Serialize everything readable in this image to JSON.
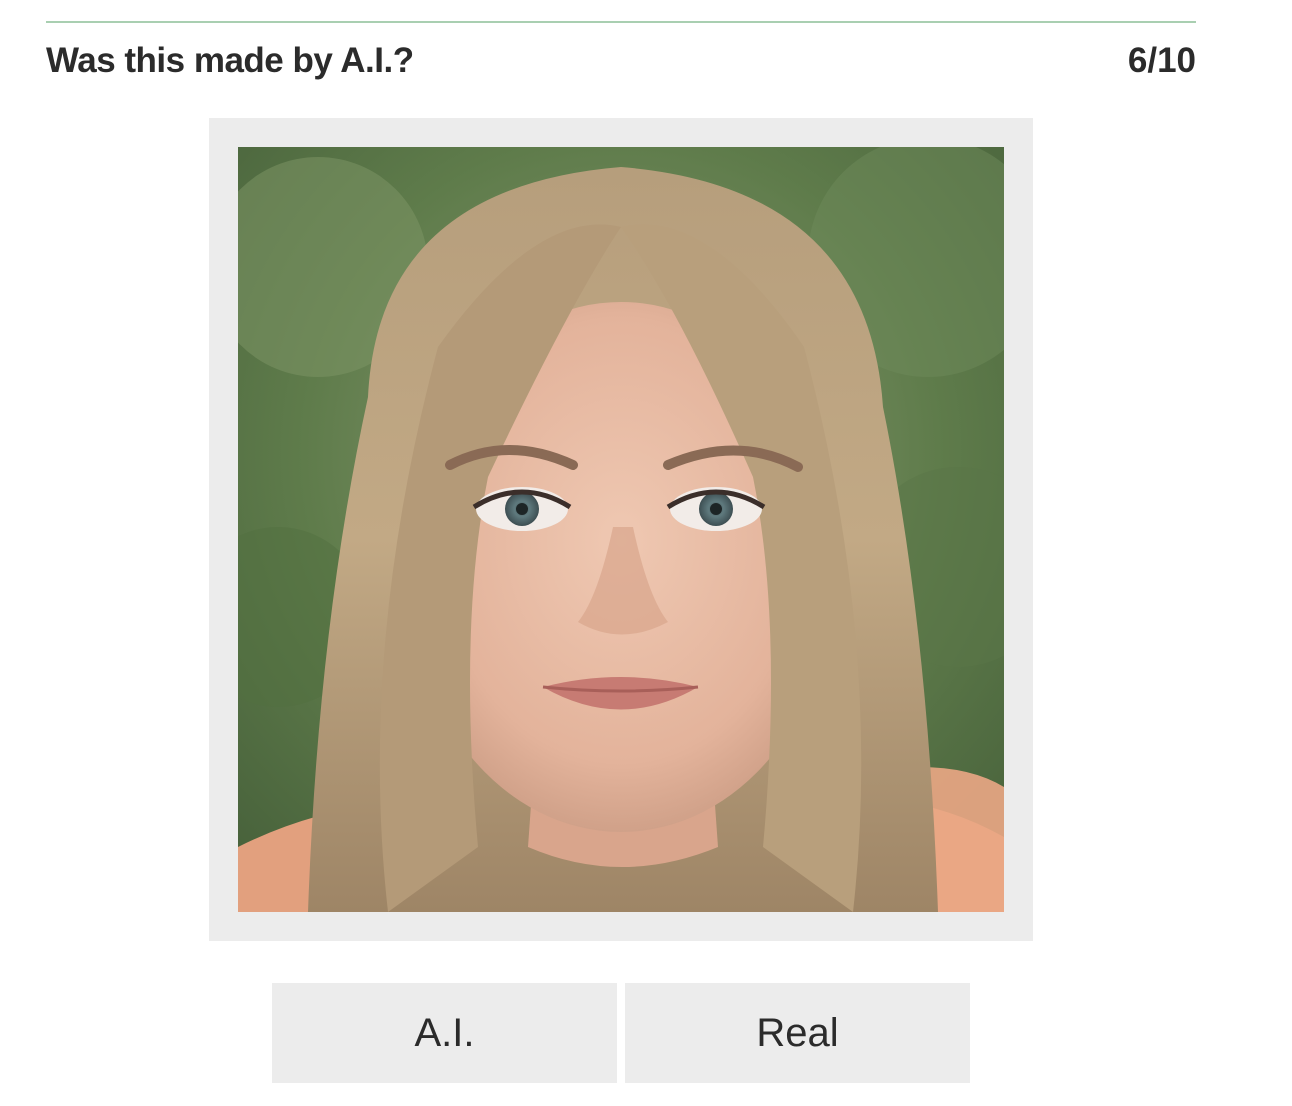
{
  "quiz": {
    "question": "Was this made by A.I.?",
    "progress": "6/10"
  },
  "image": {
    "subject": "portrait-photo"
  },
  "answers": {
    "ai_label": "A.I.",
    "real_label": "Real"
  },
  "colors": {
    "rule": "#a9cfb1",
    "frame": "#ececec",
    "button_bg": "#ececec",
    "text": "#2b2b2b"
  }
}
